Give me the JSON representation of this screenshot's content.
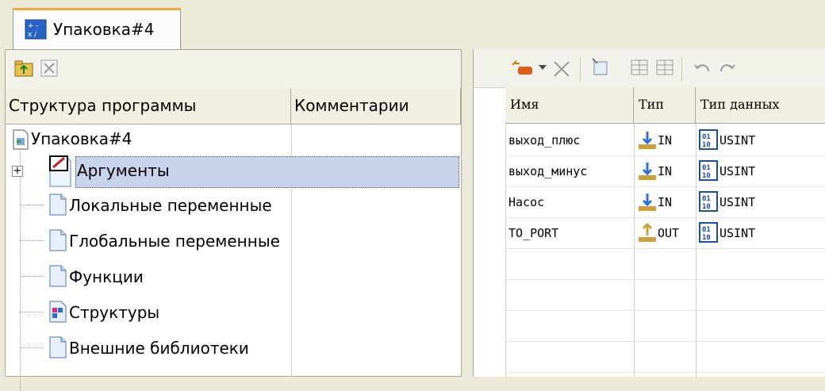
{
  "tab": {
    "label": "Упаковка#4"
  },
  "left": {
    "columns": [
      "Структура программы",
      "Комментарии"
    ],
    "root": "Упаковка#4",
    "nodes": [
      {
        "label": "Аргументы",
        "icon": "edit-doc-icon",
        "selected": true,
        "expander": "+"
      },
      {
        "label": "Локальные переменные",
        "icon": "doc-icon"
      },
      {
        "label": "Глобальные переменные",
        "icon": "doc-icon"
      },
      {
        "label": "Функции",
        "icon": "doc-icon"
      },
      {
        "label": "Структуры",
        "icon": "structure-icon"
      },
      {
        "label": "Внешние библиотеки",
        "icon": "doc-icon"
      }
    ]
  },
  "right": {
    "columns": [
      "Имя",
      "Тип",
      "Тип данных"
    ],
    "rows": [
      {
        "name": "выход_плюс",
        "dir": "IN",
        "dtype": "USINT"
      },
      {
        "name": "выход_минус",
        "dir": "IN",
        "dtype": "USINT"
      },
      {
        "name": "Насос",
        "dir": "IN",
        "dtype": "USINT"
      },
      {
        "name": "TO_PORT",
        "dir": "OUT",
        "dtype": "USINT"
      }
    ]
  },
  "colors": {
    "selection": "#c7d3ea",
    "tab_accent": "#f4a93a",
    "arrow": "#2f6fd8"
  }
}
